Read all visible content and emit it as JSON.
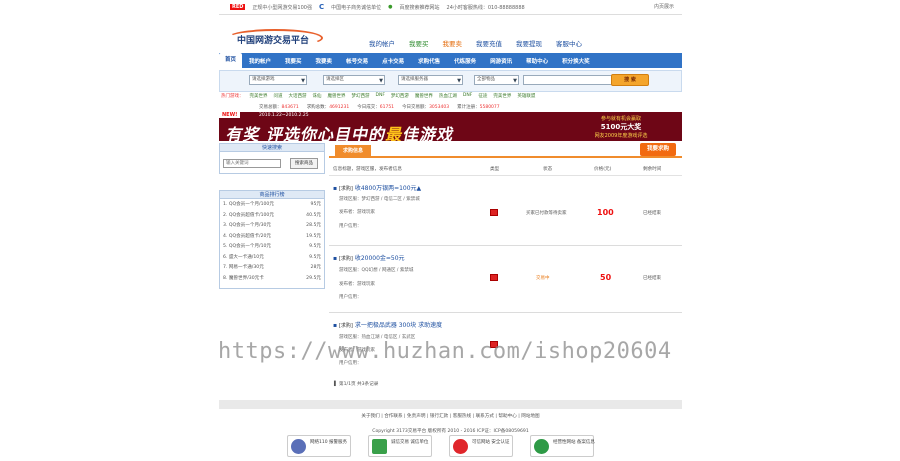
{
  "topbar": {
    "badge": "RED",
    "item1": "正规中小型网游交易100强",
    "cmark": "C",
    "item2": "中国电子商务诚信单位",
    "item3": "百度搜索推荐网站",
    "hotline": "24小时客服热线：010-88888888",
    "right": "内页展示"
  },
  "logo": {
    "text": "中国网游交易平台"
  },
  "topnav": [
    "我的帐户",
    "我要买",
    "我要卖",
    "我要充值",
    "我要提现",
    "客服中心"
  ],
  "mainnav": [
    "首页",
    "我的帐户",
    "我要买",
    "我要卖",
    "帐号交易",
    "点卡交易",
    "求购代售",
    "代练服务",
    "网游资讯",
    "帮助中心",
    "积分换大奖"
  ],
  "search": {
    "select1": "请选择游戏",
    "select2": "请选择区",
    "select3": "请选择服务器",
    "select4": "全部物品",
    "button": "搜 索"
  },
  "hot": {
    "label": "热门游戏：",
    "games": [
      "完美世界",
      "问道",
      "大话西游",
      "诛仙",
      "魔兽世界",
      "梦幻西游",
      "DNF",
      "梦幻西游",
      "魔兽世界",
      "热血江湖",
      "DNF",
      "征途",
      "完美世界",
      "英雄联盟"
    ]
  },
  "stats": {
    "a": "交易总额：",
    "a_val": "843671",
    "b": "求购总数：",
    "b_val": "4691231",
    "c": "今日成交：",
    "c_val": "61751",
    "d": "今日交易额：",
    "d_val": "3053403",
    "e": "累计注册：",
    "e_val": "5580077"
  },
  "banner": {
    "new": "NEW!",
    "dates": "2010.1.22~2010.2.25",
    "text1": "有奖",
    "text2": "评选你心目中的",
    "hl": "最",
    "text3": "佳游戏",
    "r1": "参与就有机会赢取",
    "r2": "5100元大奖",
    "r3": "网友2009年度游戏评选"
  },
  "sidebar": {
    "quick_title": "快速搜索",
    "quick_input": "输入关键词",
    "quick_btn": "搜索商品",
    "rank_title": "商品排行榜",
    "rank": [
      {
        "n": "1. QQ会员一个月/100元",
        "p": "95元"
      },
      {
        "n": "2. QQ会员超值卡/100元",
        "p": "40.5元"
      },
      {
        "n": "3. QQ会员一个月/30元",
        "p": "28.5元"
      },
      {
        "n": "4. QQ会员超值卡/20元",
        "p": "19.5元"
      },
      {
        "n": "5. QQ会员一个月/10元",
        "p": "9.5元"
      },
      {
        "n": "6. 盛大一卡通/10元",
        "p": "9.5元"
      },
      {
        "n": "7. 网易一卡通/30元",
        "p": "28元"
      },
      {
        "n": "8. 魔兽世界/30元卡",
        "p": "29.5元"
      }
    ]
  },
  "content": {
    "tab": "求购信息",
    "post_btn": "我要求购",
    "cols": [
      "信息标题，游戏区服，发布者信息",
      "类型",
      "状态",
      "价格(元)",
      "剩余时间"
    ],
    "items": [
      {
        "tag": "[求购]",
        "title": "收4800万银两=100元▲",
        "l1": "游戏区服：梦幻西游 / 电信二区 / 紫禁城",
        "l2": "发布者：游戏玩家",
        "l3": "用户信用：",
        "status": "买家已付款等待卖家",
        "price": "100",
        "time": "已经结束"
      },
      {
        "tag": "[求购]",
        "title": "收20000金=50元",
        "l1": "游戏区服：QQ幻想 / 网通区 / 紫禁城",
        "l2": "发布者：游戏玩家",
        "l3": "用户信用：",
        "status": "交易中",
        "price": "50",
        "time": "已经结束"
      },
      {
        "tag": "[求购]",
        "title": "求一把极品武器 300块 求助速度",
        "l1": "游戏区服：热血江湖 / 电信区 / 玄武区",
        "l2": "发布者：游戏玩家",
        "l3": "用户信用：",
        "status": "",
        "price": "",
        "time": ""
      }
    ],
    "pager": "第1/1页 共3条记录"
  },
  "footer": {
    "links": "关于我们 | 合作联系 | 免责声明 | 银行汇款 | 客服热线 | 联系方式 | 帮助中心 | 网站地图",
    "copy": "Copyright  3173交易平台 版权所有  2010 - 2016    ICP证：ICP备08059691",
    "badges": [
      "网络110 报警服务",
      "诚信交易 诚信单位",
      "可信网站 安全认证",
      "经营性网站 备案信息"
    ]
  },
  "watermark": "https://www.huzhan.com/ishop20604"
}
